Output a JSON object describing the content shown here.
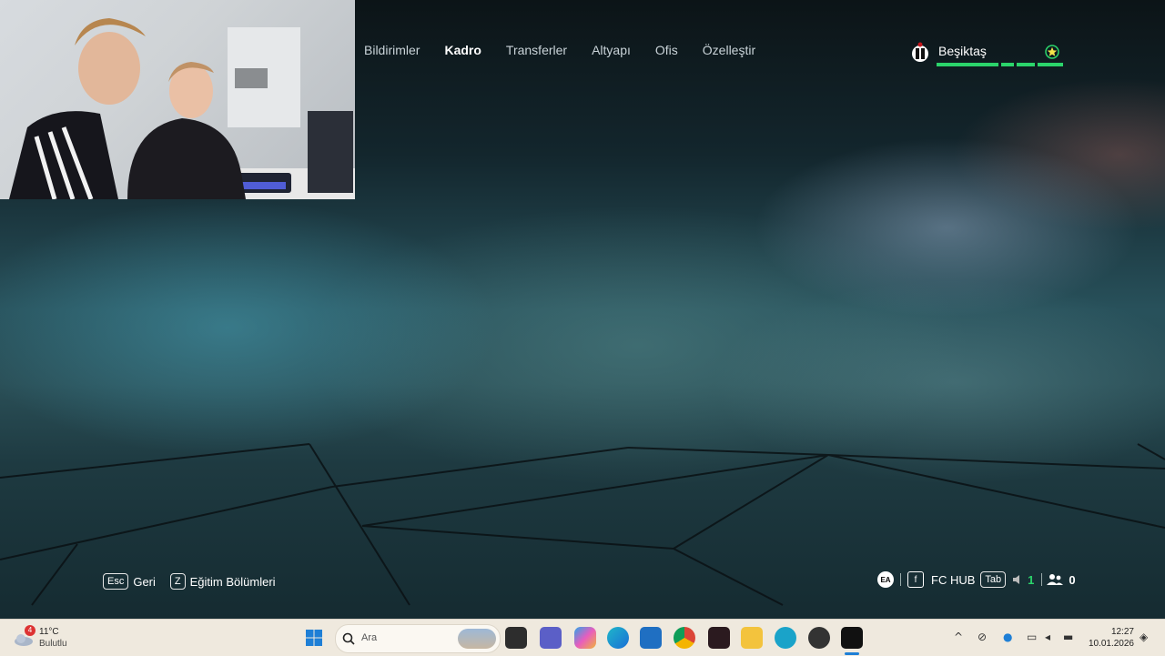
{
  "top_menu": {
    "items": [
      {
        "label": "Bildirimler",
        "active": false
      },
      {
        "label": "Kadro",
        "active": true
      },
      {
        "label": "Transferler",
        "active": false
      },
      {
        "label": "Altyapı",
        "active": false
      },
      {
        "label": "Ofis",
        "active": false
      },
      {
        "label": "Özelleştir",
        "active": false
      }
    ]
  },
  "club": {
    "name": "Beşiktaş",
    "accent": "#2bd46b"
  },
  "hints": [
    {
      "key": "Esc",
      "label": "Geri"
    },
    {
      "key": "Z",
      "label": "Eğitim Bölümleri"
    }
  ],
  "hud": {
    "ea_label": "EA",
    "f_key": "f",
    "fc_hub": "FC HUB",
    "tab_key": "Tab",
    "count1": "1",
    "count2": "0"
  },
  "taskbar": {
    "weather_badge": "4",
    "temperature": "11°C",
    "condition": "Bulutlu",
    "search_placeholder": "Ara",
    "time": "12:27",
    "date": "10.01.2026"
  }
}
